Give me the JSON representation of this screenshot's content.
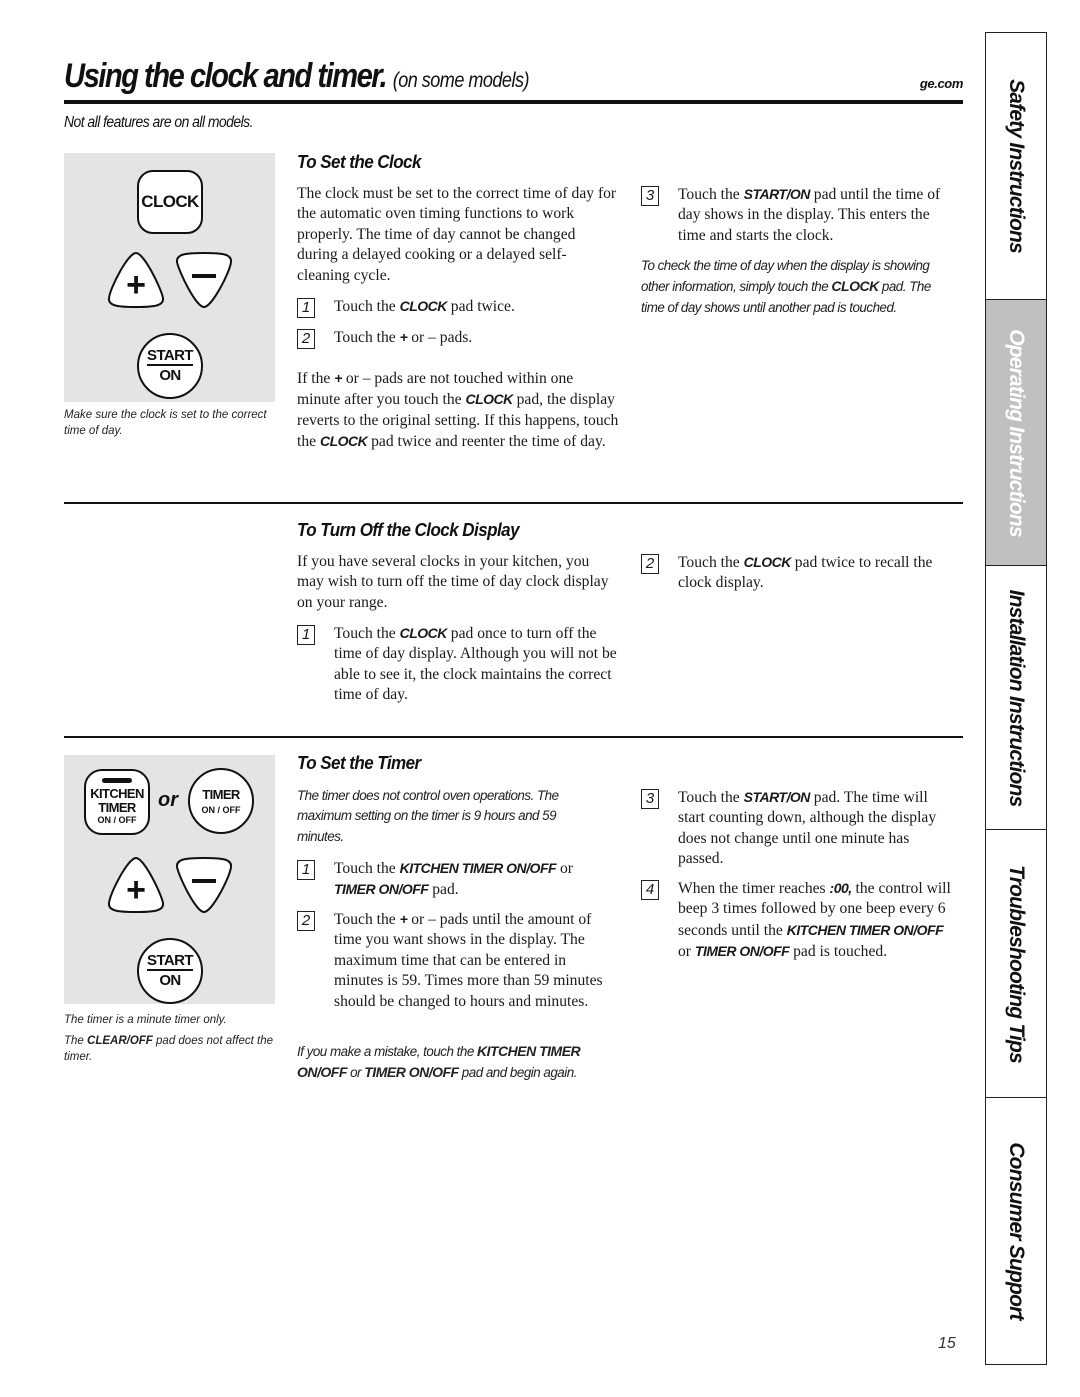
{
  "header": {
    "title": "Using the clock and timer.",
    "title_sub": "(on some models)",
    "site": "ge.com",
    "note": "Not all features are on all models."
  },
  "clock_panel": {
    "clock_pad": "CLOCK",
    "plus_pad": "+",
    "minus_pad": "−",
    "start_pad_top": "START",
    "start_pad_bottom": "ON",
    "caption": "Make sure the clock is set to the correct time of day."
  },
  "set_clock": {
    "heading": "To Set the Clock",
    "intro": "The clock must be set to the correct time of day for the automatic oven timing functions to work properly. The time of day cannot be changed during a delayed cooking or a delayed self-cleaning cycle.",
    "steps": [
      {
        "num": "1",
        "pre": "Touch the ",
        "bold": "CLOCK",
        "post": " pad twice."
      },
      {
        "num": "2",
        "pre": "Touch the ",
        "bold": "+",
        "post": " or – pads."
      },
      {
        "num": "3",
        "pre": "Touch the ",
        "bold": "START/ON",
        "post": " pad until the time of day shows in the display. This enters the time and starts the clock."
      }
    ],
    "timeout_note": {
      "p1": "If the ",
      "b1": "+",
      "p2": " or – pads are not touched within one minute after you touch the ",
      "b2": "CLOCK",
      "p3": " pad, the display reverts to the original setting. If this happens, touch the ",
      "b3": "CLOCK",
      "p4": " pad twice and reenter the time of day."
    },
    "check_note": {
      "p1": "To check the time of day when the display is showing other information, simply touch the ",
      "b1": "CLOCK",
      "p2": " pad. The time of day shows until another pad is touched."
    }
  },
  "turn_off_display": {
    "heading": "To Turn Off the Clock Display",
    "intro": "If you have several clocks in your kitchen, you may wish to turn off the time of day clock display on your range.",
    "steps": [
      {
        "num": "1",
        "pre": "Touch the ",
        "bold": "CLOCK",
        "post": " pad once to turn off the time of day display. Although you will not be able to see it, the clock maintains the correct time of day."
      },
      {
        "num": "2",
        "pre": "Touch the ",
        "bold": "CLOCK",
        "post": " pad twice to recall the clock display."
      }
    ]
  },
  "timer_panel": {
    "kitchen_pad_l1": "KITCHEN",
    "kitchen_pad_l2": "TIMER",
    "kitchen_pad_l3": "ON / OFF",
    "or_label": "or",
    "timer_pad_l1": "TIMER",
    "timer_pad_l2": "ON / OFF",
    "plus_pad": "+",
    "minus_pad": "−",
    "start_pad_top": "START",
    "start_pad_bottom": "ON",
    "caption1": "The timer is a minute timer only.",
    "caption2_pre": "The ",
    "caption2_bold": "CLEAR/OFF",
    "caption2_post": " pad does not affect the timer."
  },
  "set_timer": {
    "heading": "To Set the Timer",
    "intro": "The timer does not control oven operations. The maximum setting on the timer is 9 hours and 59 minutes.",
    "step1": {
      "num": "1",
      "pre": "Touch the ",
      "b1": "KITCHEN TIMER ON/OFF",
      "mid": " or ",
      "b2": "TIMER ON/OFF",
      "post": " pad."
    },
    "step2": {
      "num": "2",
      "pre": "Touch the ",
      "bold": "+",
      "post": " or – pads until the amount of time you want shows in the display. The maximum time that can be entered in minutes is 59. Times more than 59 minutes should be changed to hours and minutes."
    },
    "step3": {
      "num": "3",
      "pre": "Touch the ",
      "bold": "START/ON",
      "post": " pad. The time will start counting down, although the display does not change until one minute has passed."
    },
    "step4": {
      "num": "4",
      "pre": "When the timer reaches ",
      "b1": ":00,",
      "mid": " the control will beep 3 times followed by one beep every 6 seconds until the ",
      "b2": "KITCHEN TIMER ON/OFF",
      "mid2": " or ",
      "b3": "TIMER ON/OFF",
      "post": " pad is touched."
    },
    "mistake_note": {
      "p1": "If you make a mistake, touch the ",
      "b1": "KITCHEN TIMER ON/OFF",
      "p2": " or ",
      "b2": "TIMER ON/OFF",
      "p3": " pad and begin again."
    }
  },
  "side_tabs": [
    {
      "label": "Safety Instructions",
      "active": false
    },
    {
      "label": "Operating Instructions",
      "active": true
    },
    {
      "label": "Installation Instructions",
      "active": false
    },
    {
      "label": "Troubleshooting Tips",
      "active": false
    },
    {
      "label": "Consumer Support",
      "active": false
    }
  ],
  "colors": {
    "active_tab": "#c0c0c0",
    "panel_bg": "#e4e4e4",
    "text": "#111111"
  },
  "page_number": "15"
}
